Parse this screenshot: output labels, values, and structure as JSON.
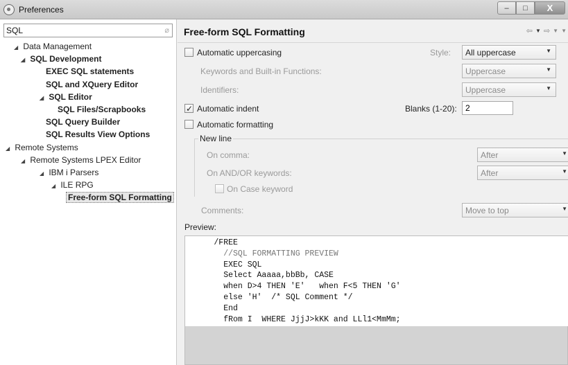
{
  "window": {
    "title": "Preferences",
    "minimize": "–",
    "maximize": "□",
    "close": "X"
  },
  "filter": {
    "value": "SQL",
    "clear_glyph": "⌀"
  },
  "tree": [
    {
      "label": "Data Management",
      "expanded": true
    },
    {
      "label": "SQL Development",
      "expanded": true
    },
    {
      "label": "EXEC SQL statements"
    },
    {
      "label": "SQL and XQuery Editor"
    },
    {
      "label": "SQL Editor",
      "expanded": true
    },
    {
      "label": "SQL Files/Scrapbooks"
    },
    {
      "label": "SQL Query Builder"
    },
    {
      "label": "SQL Results View Options"
    },
    {
      "label": "Remote Systems",
      "expanded": true
    },
    {
      "label": "Remote Systems LPEX Editor",
      "expanded": true
    },
    {
      "label": "IBM i Parsers",
      "expanded": true
    },
    {
      "label": "ILE RPG",
      "expanded": true
    },
    {
      "label": "Free-form SQL Formatting",
      "selected": true
    }
  ],
  "page": {
    "title": "Free-form SQL Formatting",
    "nav": {
      "back": "⇦",
      "back_menu": "▼",
      "forward": "⇨",
      "forward_menu": "▼",
      "view_menu": "▼"
    },
    "auto_uppercasing": {
      "label": "Automatic uppercasing",
      "checked": false
    },
    "style": {
      "label": "Style:",
      "value": "All uppercase"
    },
    "keywords": {
      "label": "Keywords and Built-in Functions:",
      "value": "Uppercase"
    },
    "identifiers": {
      "label": "Identifiers:",
      "value": "Uppercase"
    },
    "auto_indent": {
      "label": "Automatic indent",
      "checked": true
    },
    "blanks": {
      "label": "Blanks (1-20):",
      "value": "2"
    },
    "auto_formatting": {
      "label": "Automatic formatting",
      "checked": false
    },
    "new_line": {
      "title": "New line",
      "on_comma": {
        "label": "On comma:",
        "value": "After"
      },
      "on_andor": {
        "label": "On AND/OR keywords:",
        "value": "After"
      },
      "on_case": {
        "label": "On Case keyword",
        "checked": false
      }
    },
    "comments": {
      "label": "Comments:",
      "value": "Move to top"
    },
    "preview": {
      "label": "Preview:",
      "lines": [
        "      /FREE",
        "        //SQL FORMATTING PREVIEW",
        "        EXEC SQL",
        "        Select Aaaaa,bbBb, CASE",
        "        when D>4 THEN 'E'   when F<5 THEN 'G'",
        "        else 'H'  /* SQL Comment */",
        "        End",
        "        fRom I  WHERE JjjJ>kKK and LLl1<MmMm;"
      ]
    }
  },
  "icons": {
    "dropdown": "▼",
    "expanded_arrow": "◢"
  }
}
